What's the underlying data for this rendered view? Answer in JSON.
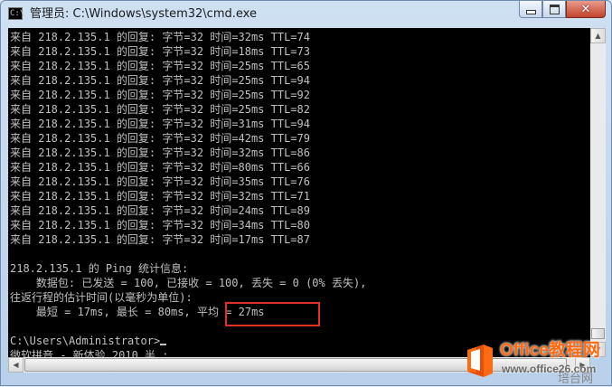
{
  "window": {
    "icon_text": "C:\\",
    "title": "管理员: C:\\Windows\\system32\\cmd.exe",
    "controls": {
      "minimize_icon": "minimize-icon",
      "maximize_icon": "maximize-icon",
      "close_icon": "close-icon",
      "close_glyph": "✕"
    }
  },
  "console": {
    "foreground": "#c0c0c0",
    "background": "#000000",
    "lines": [
      "来自 218.2.135.1 的回复: 字节=32 时间=32ms TTL=74",
      "来自 218.2.135.1 的回复: 字节=32 时间=18ms TTL=73",
      "来自 218.2.135.1 的回复: 字节=32 时间=25ms TTL=65",
      "来自 218.2.135.1 的回复: 字节=32 时间=25ms TTL=94",
      "来自 218.2.135.1 的回复: 字节=32 时间=25ms TTL=92",
      "来自 218.2.135.1 的回复: 字节=32 时间=25ms TTL=82",
      "来自 218.2.135.1 的回复: 字节=32 时间=31ms TTL=94",
      "来自 218.2.135.1 的回复: 字节=32 时间=42ms TTL=79",
      "来自 218.2.135.1 的回复: 字节=32 时间=32ms TTL=86",
      "来自 218.2.135.1 的回复: 字节=32 时间=80ms TTL=66",
      "来自 218.2.135.1 的回复: 字节=32 时间=35ms TTL=76",
      "来自 218.2.135.1 的回复: 字节=32 时间=32ms TTL=71",
      "来自 218.2.135.1 的回复: 字节=32 时间=24ms TTL=89",
      "来自 218.2.135.1 的回复: 字节=32 时间=34ms TTL=80",
      "来自 218.2.135.1 的回复: 字节=32 时间=17ms TTL=87",
      "",
      "218.2.135.1 的 Ping 统计信息:",
      "    数据包: 已发送 = 100, 已接收 = 100, 丢失 = 0 (0% 丢失),",
      "往返行程的估计时间(以毫秒为单位):",
      "    最短 = 17ms, 最长 = 80ms, 平均 = 27ms",
      "",
      "C:\\Users\\Administrator>",
      "微软拼音 - 新体验 2010 半 :"
    ],
    "highlight_text": "平均 = 27ms",
    "highlight_color": "#e0322a"
  },
  "scrollbars": {
    "up_glyph": "▲",
    "down_glyph": "▼",
    "left_glyph": "◀",
    "right_glyph": "▶"
  },
  "watermark": {
    "brand": "Office教程网",
    "url": "www.office26.com",
    "sub": "培台网",
    "brand_color": "#ff6a13"
  }
}
